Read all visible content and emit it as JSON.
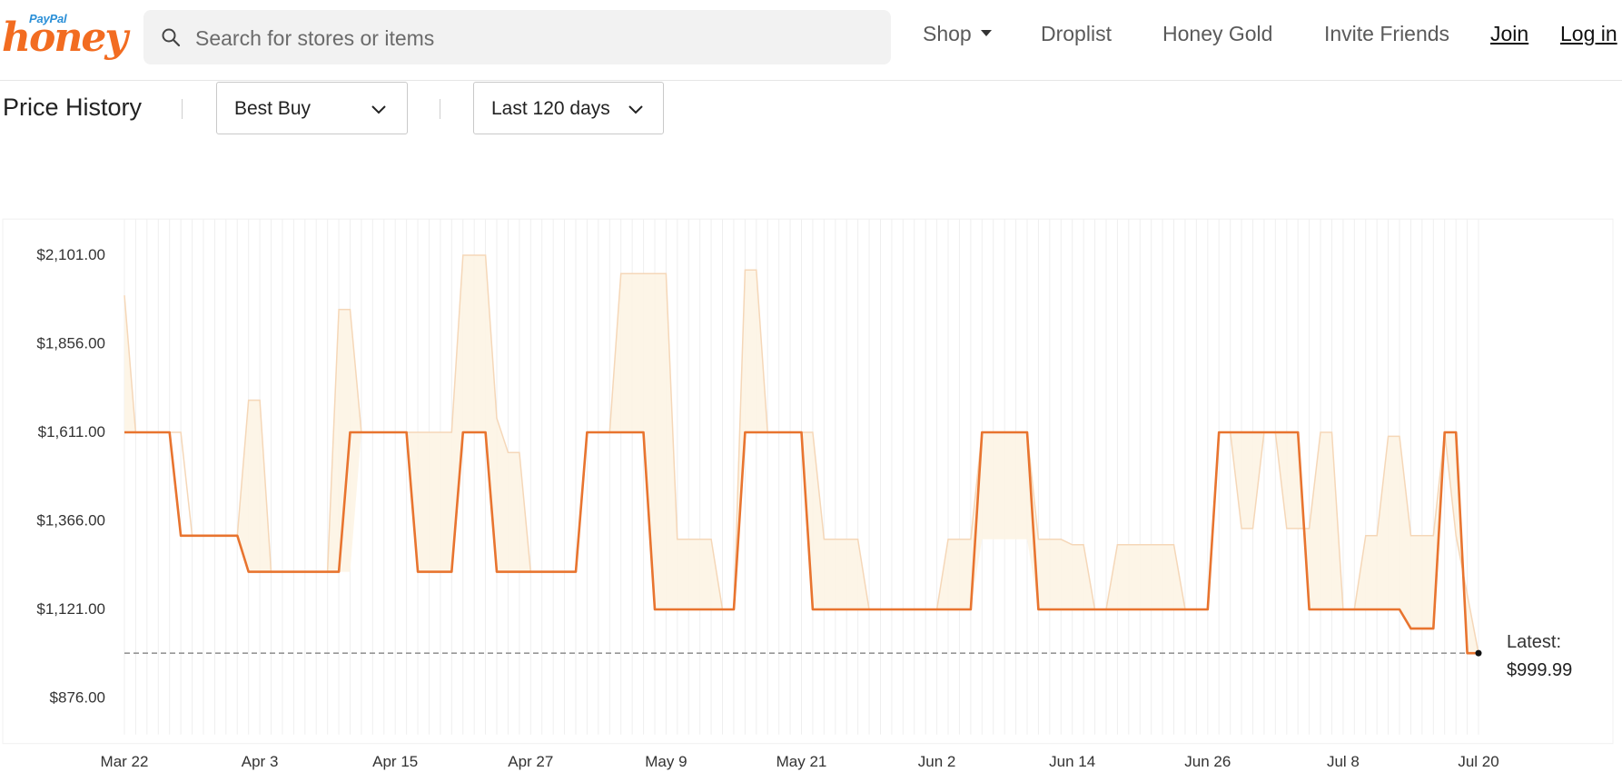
{
  "header": {
    "logo_top": "PayPal",
    "logo_main": "honey",
    "search_placeholder": "Search for stores or items",
    "nav": {
      "shop": "Shop",
      "droplist": "Droplist",
      "honey_gold": "Honey Gold",
      "invite": "Invite Friends",
      "join": "Join",
      "login": "Log in"
    }
  },
  "controls": {
    "title": "Price History",
    "store": "Best Buy",
    "range": "Last 120 days"
  },
  "colors": {
    "accent": "#f26c21",
    "line": "#e8742f",
    "band_fill": "#fdf4e4",
    "band_stroke": "#f5d7b8"
  },
  "chart_data": {
    "type": "line",
    "title": "Price History",
    "xlabel": "",
    "ylabel": "",
    "ylim": [
      775,
      2201
    ],
    "x_tick_labels": [
      "Mar 22",
      "Apr 3",
      "Apr 15",
      "Apr 27",
      "May 9",
      "May 21",
      "Jun 2",
      "Jun 14",
      "Jun 26",
      "Jul 8",
      "Jul 20"
    ],
    "y_tick_labels": [
      "$2,101.00",
      "$1,856.00",
      "$1,611.00",
      "$1,366.00",
      "$1,121.00",
      "$876.00"
    ],
    "y_tick_values": [
      2101,
      1856,
      1611,
      1366,
      1121,
      876
    ],
    "latest": {
      "label": "Latest:",
      "value": "$999.99",
      "price": 999.99
    },
    "reference_line": 999.99,
    "grid": "vertical-daily",
    "series": [
      {
        "style": "price",
        "points": [
          [
            0,
            1611
          ],
          [
            4,
            1611
          ],
          [
            5,
            1325
          ],
          [
            10,
            1325
          ],
          [
            11,
            1225
          ],
          [
            19,
            1225
          ],
          [
            20,
            1611
          ],
          [
            25,
            1611
          ],
          [
            26,
            1225
          ],
          [
            29,
            1225
          ],
          [
            30,
            1611
          ],
          [
            32,
            1611
          ],
          [
            33,
            1225
          ],
          [
            40,
            1225
          ],
          [
            41,
            1611
          ],
          [
            46,
            1611
          ],
          [
            47,
            1121
          ],
          [
            54,
            1121
          ],
          [
            55,
            1611
          ],
          [
            60,
            1611
          ],
          [
            61,
            1121
          ],
          [
            75,
            1121
          ],
          [
            76,
            1611
          ],
          [
            80,
            1611
          ],
          [
            81,
            1121
          ],
          [
            96,
            1121
          ],
          [
            97,
            1611
          ],
          [
            104,
            1611
          ],
          [
            105,
            1121
          ],
          [
            113,
            1121
          ],
          [
            114,
            1068
          ],
          [
            116,
            1068
          ],
          [
            117,
            1611
          ],
          [
            118,
            1611
          ],
          [
            119,
            999.99
          ],
          [
            120,
            999.99
          ]
        ]
      },
      {
        "style": "range",
        "upper": [
          [
            0,
            1990
          ],
          [
            1,
            1611
          ],
          [
            5,
            1611
          ],
          [
            6,
            1325
          ],
          [
            10,
            1325
          ],
          [
            11,
            1700
          ],
          [
            12,
            1700
          ],
          [
            13,
            1225
          ],
          [
            18,
            1225
          ],
          [
            19,
            1951
          ],
          [
            20,
            1951
          ],
          [
            21,
            1611
          ],
          [
            29,
            1611
          ],
          [
            30,
            2101
          ],
          [
            32,
            2101
          ],
          [
            33,
            1650
          ],
          [
            34,
            1555
          ],
          [
            35,
            1555
          ],
          [
            36,
            1225
          ],
          [
            40,
            1225
          ],
          [
            41,
            1611
          ],
          [
            43,
            1611
          ],
          [
            44,
            2050
          ],
          [
            48,
            2050
          ],
          [
            49,
            1315
          ],
          [
            52,
            1315
          ],
          [
            53,
            1121
          ],
          [
            54,
            1121
          ],
          [
            55,
            2060
          ],
          [
            56,
            2060
          ],
          [
            57,
            1611
          ],
          [
            61,
            1611
          ],
          [
            62,
            1315
          ],
          [
            65,
            1315
          ],
          [
            66,
            1121
          ],
          [
            72,
            1121
          ],
          [
            73,
            1315
          ],
          [
            75,
            1315
          ],
          [
            76,
            1611
          ],
          [
            80,
            1611
          ],
          [
            81,
            1315
          ],
          [
            83,
            1315
          ],
          [
            84,
            1300
          ],
          [
            85,
            1300
          ],
          [
            86,
            1121
          ],
          [
            87,
            1121
          ],
          [
            88,
            1300
          ],
          [
            93,
            1300
          ],
          [
            94,
            1121
          ],
          [
            96,
            1121
          ],
          [
            97,
            1611
          ],
          [
            98,
            1611
          ],
          [
            99,
            1345
          ],
          [
            100,
            1345
          ],
          [
            101,
            1611
          ],
          [
            102,
            1611
          ],
          [
            103,
            1345
          ],
          [
            105,
            1345
          ],
          [
            106,
            1611
          ],
          [
            107,
            1611
          ],
          [
            108,
            1121
          ],
          [
            109,
            1121
          ],
          [
            110,
            1325
          ],
          [
            111,
            1325
          ],
          [
            112,
            1600
          ],
          [
            113,
            1600
          ],
          [
            114,
            1325
          ],
          [
            116,
            1325
          ],
          [
            117,
            1611
          ],
          [
            118,
            1325
          ],
          [
            120,
            999.99
          ]
        ],
        "lower": [
          [
            0,
            1611
          ],
          [
            5,
            1611
          ],
          [
            6,
            1325
          ],
          [
            10,
            1325
          ],
          [
            11,
            1225
          ],
          [
            20,
            1225
          ],
          [
            21,
            1611
          ],
          [
            25,
            1611
          ],
          [
            26,
            1225
          ],
          [
            29,
            1225
          ],
          [
            30,
            1611
          ],
          [
            32,
            1611
          ],
          [
            33,
            1225
          ],
          [
            40,
            1225
          ],
          [
            41,
            1611
          ],
          [
            46,
            1611
          ],
          [
            47,
            1121
          ],
          [
            54,
            1121
          ],
          [
            55,
            1611
          ],
          [
            60,
            1611
          ],
          [
            61,
            1121
          ],
          [
            75,
            1121
          ],
          [
            76,
            1315
          ],
          [
            80,
            1315
          ],
          [
            81,
            1121
          ],
          [
            96,
            1121
          ],
          [
            97,
            1611
          ],
          [
            104,
            1611
          ],
          [
            105,
            1121
          ],
          [
            113,
            1121
          ],
          [
            114,
            1068
          ],
          [
            116,
            1068
          ],
          [
            117,
            1611
          ],
          [
            118,
            1611
          ],
          [
            119,
            999.99
          ],
          [
            120,
            999.99
          ]
        ]
      }
    ]
  }
}
